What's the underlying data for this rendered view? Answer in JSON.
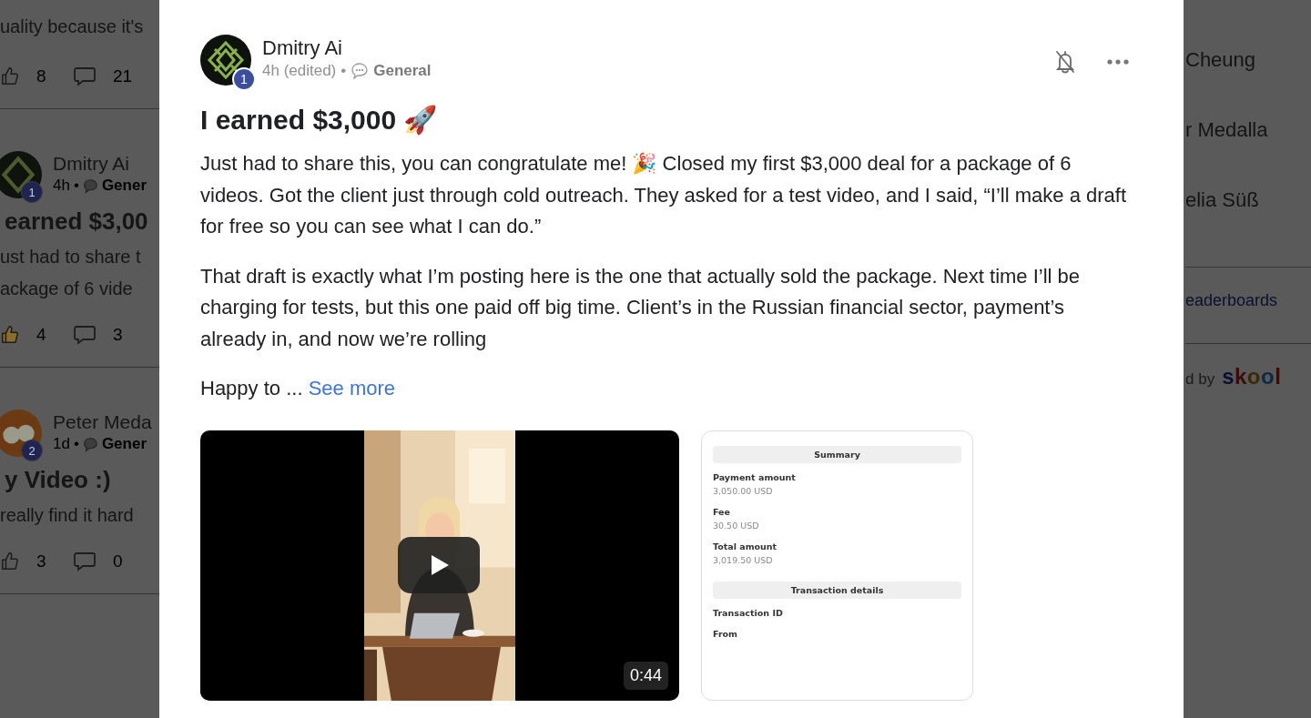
{
  "feed": {
    "posts": [
      {
        "snippet_lines": [
          "uality because it's"
        ],
        "liked": false,
        "likes": "8",
        "comments": "21"
      },
      {
        "author": "Dmitry Ai",
        "level": "1",
        "time": "4h",
        "separator": "•",
        "category": "Gener",
        "title": "earned $3,00",
        "snippet_lines": [
          "ust had to share t",
          "ackage of 6 vide"
        ],
        "liked": true,
        "likes": "4",
        "comments": "3"
      },
      {
        "author": "Peter Meda",
        "level": "2",
        "time": "1d",
        "separator": "•",
        "category": "Gener",
        "title": "y Video :)",
        "snippet_lines": [
          "really find it hard"
        ],
        "liked": false,
        "likes": "3",
        "comments": "0"
      }
    ]
  },
  "sidebar": {
    "members": [
      "Cheung",
      "r Medalla",
      "elia Süß"
    ],
    "link": "eaderboards",
    "powered_by": "d by",
    "logo": "skool"
  },
  "post": {
    "author": "Dmitry Ai",
    "level": "1",
    "time": "4h (edited)",
    "separator": "•",
    "category": "General",
    "title": "I earned $3,000 🚀",
    "paragraphs": [
      "Just had to share this, you can congratulate me! 🎉 Closed my first $3,000 deal for a package of 6 videos. Got the client just through cold outreach. They asked for a test video, and I said, “I’ll make a draft for free so you can see what I can do.”",
      "That draft is exactly what I’m posting here is the one that actually sold the package. Next time I’ll be charging for tests, but this one paid off big time. Client’s in the Russian financial sector, payment’s already in, and now we’re rolling"
    ],
    "teaser": "Happy to ...",
    "see_more": "See more",
    "video": {
      "duration": "0:44"
    },
    "receipt": {
      "sections": [
        {
          "heading": "Summary",
          "fields": [
            {
              "label": "Payment amount",
              "value": "3,050.00 USD"
            },
            {
              "label": "Fee",
              "value": "30.50 USD"
            },
            {
              "label": "Total amount",
              "value": "3,019.50 USD"
            }
          ]
        },
        {
          "heading": "Transaction details",
          "fields": [
            {
              "label": "Transaction ID"
            },
            {
              "label": "From"
            }
          ]
        }
      ]
    }
  }
}
